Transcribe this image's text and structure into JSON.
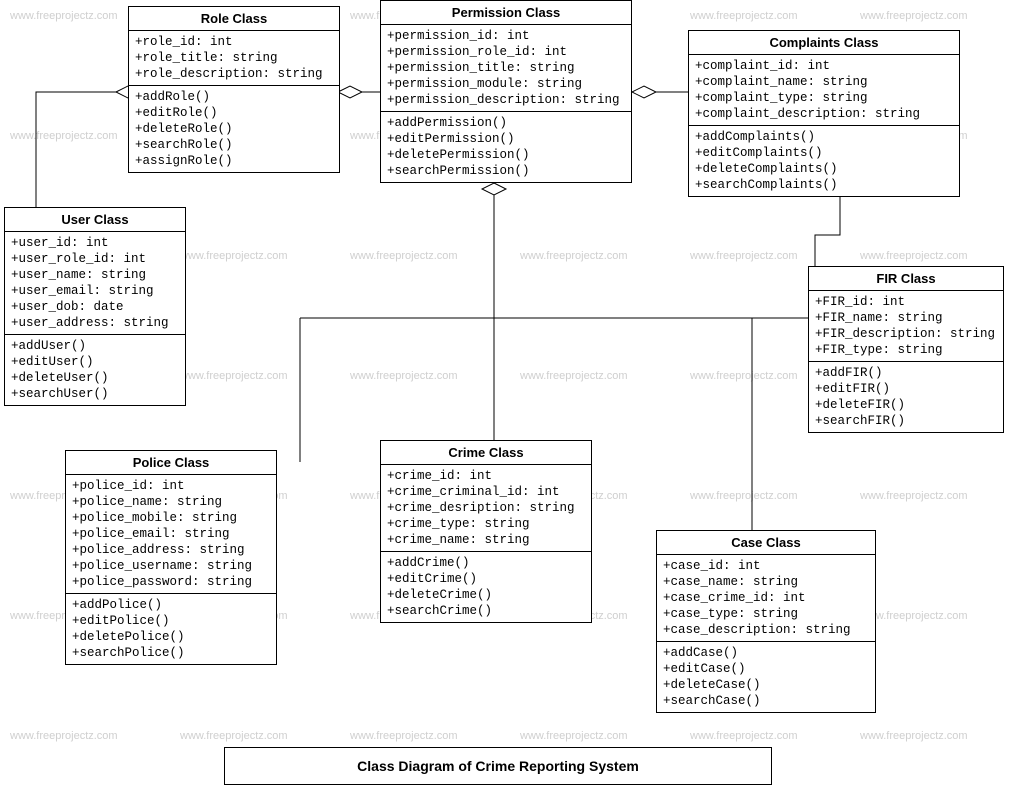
{
  "diagramTitle": "Class Diagram of Crime Reporting System",
  "watermark": "www.freeprojectz.com",
  "classes": {
    "role": {
      "name": "Role Class",
      "attrs": [
        "+role_id: int",
        "+role_title: string",
        "+role_description: string"
      ],
      "methods": [
        "+addRole()",
        "+editRole()",
        "+deleteRole()",
        "+searchRole()",
        "+assignRole()"
      ]
    },
    "permission": {
      "name": "Permission Class",
      "attrs": [
        "+permission_id: int",
        "+permission_role_id: int",
        "+permission_title: string",
        "+permission_module: string",
        "+permission_description: string"
      ],
      "methods": [
        "+addPermission()",
        "+editPermission()",
        "+deletePermission()",
        "+searchPermission()"
      ]
    },
    "complaints": {
      "name": "Complaints Class",
      "attrs": [
        "+complaint_id: int",
        "+complaint_name: string",
        "+complaint_type: string",
        "+complaint_description: string"
      ],
      "methods": [
        "+addComplaints()",
        "+editComplaints()",
        "+deleteComplaints()",
        "+searchComplaints()"
      ]
    },
    "user": {
      "name": "User Class",
      "attrs": [
        "+user_id: int",
        "+user_role_id: int",
        "+user_name: string",
        "+user_email: string",
        "+user_dob: date",
        "+user_address: string"
      ],
      "methods": [
        "+addUser()",
        "+editUser()",
        "+deleteUser()",
        "+searchUser()"
      ]
    },
    "fir": {
      "name": "FIR Class",
      "attrs": [
        "+FIR_id: int",
        "+FIR_name: string",
        "+FIR_description: string",
        "+FIR_type: string"
      ],
      "methods": [
        "+addFIR()",
        "+editFIR()",
        "+deleteFIR()",
        "+searchFIR()"
      ]
    },
    "police": {
      "name": "Police Class",
      "attrs": [
        "+police_id: int",
        "+police_name: string",
        "+police_mobile: string",
        "+police_email: string",
        "+police_address: string",
        "+police_username: string",
        "+police_password: string"
      ],
      "methods": [
        "+addPolice()",
        "+editPolice()",
        "+deletePolice()",
        "+searchPolice()"
      ]
    },
    "crime": {
      "name": "Crime Class",
      "attrs": [
        "+crime_id: int",
        "+crime_criminal_id: int",
        "+crime_desription: string",
        "+crime_type: string",
        "+crime_name: string"
      ],
      "methods": [
        "+addCrime()",
        "+editCrime()",
        "+deleteCrime()",
        "+searchCrime()"
      ]
    },
    "casec": {
      "name": "Case Class",
      "attrs": [
        "+case_id: int",
        "+case_name: string",
        "+case_crime_id: int",
        "+case_type: string",
        "+case_description: string"
      ],
      "methods": [
        "+addCase()",
        "+editCase()",
        "+deleteCase()",
        "+searchCase()"
      ]
    }
  }
}
